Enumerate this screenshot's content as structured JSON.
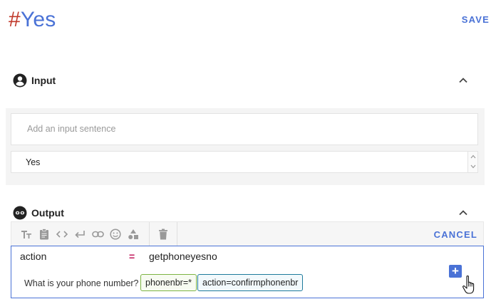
{
  "header": {
    "hash": "#",
    "title": "Yes",
    "save_label": "SAVE"
  },
  "input_section": {
    "title": "Input",
    "icon": "account-circle-icon",
    "placeholder": "Add an input sentence",
    "value": "Yes"
  },
  "output_section": {
    "title": "Output",
    "icon": "bot-mask-icon",
    "toolbar": {
      "icons": [
        "text-size-icon",
        "clipboard-icon",
        "code-icon",
        "return-icon",
        "link-icon",
        "emoji-icon",
        "shapes-icon"
      ],
      "delete_icon": "trash-icon",
      "cancel_label": "CANCEL"
    },
    "editor": {
      "key": "action",
      "operator": "=",
      "value": "getphoneyesno",
      "prompt": "What is your phone number?",
      "chips": [
        "phonenbr=*",
        "action=confirmphonenbr"
      ],
      "add_label": "+"
    }
  },
  "colors": {
    "accent": "#4a72d6",
    "hash": "#c0392b",
    "operator": "#c2185b",
    "chip_green": "#7cb342",
    "chip_blue": "#1e7a9c"
  }
}
